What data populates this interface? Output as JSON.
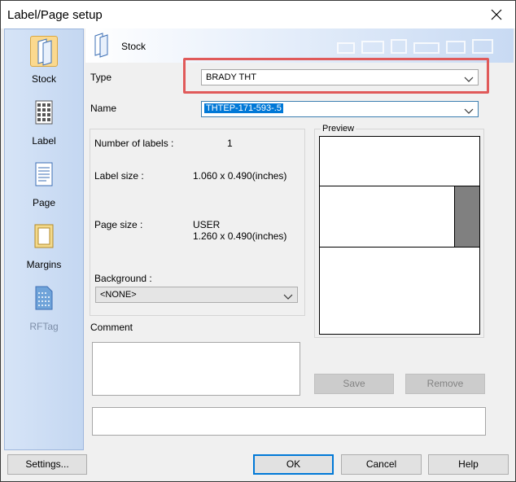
{
  "window": {
    "title": "Label/Page setup"
  },
  "sidebar": {
    "items": [
      {
        "label": "Stock",
        "icon": "stock-icon",
        "selected": true,
        "enabled": true
      },
      {
        "label": "Label",
        "icon": "label-icon",
        "selected": false,
        "enabled": true
      },
      {
        "label": "Page",
        "icon": "page-icon",
        "selected": false,
        "enabled": true
      },
      {
        "label": "Margins",
        "icon": "margins-icon",
        "selected": false,
        "enabled": true
      },
      {
        "label": "RFTag",
        "icon": "rftag-icon",
        "selected": false,
        "enabled": false
      }
    ]
  },
  "banner": {
    "title": "Stock"
  },
  "form": {
    "type_label": "Type",
    "type_value": "BRADY THT",
    "name_label": "Name",
    "name_value": "THTEP-171-593-.5"
  },
  "info": {
    "num_labels_label": "Number of labels :",
    "num_labels_value": "1",
    "label_size_label": "Label size :",
    "label_size_value": "1.060 x 0.490(inches)",
    "page_size_label": "Page size :",
    "page_size_value_line1": "USER",
    "page_size_value_line2": "1.260 x 0.490(inches)",
    "background_label": "Background :",
    "background_value": "<NONE>"
  },
  "preview": {
    "legend": "Preview"
  },
  "comment": {
    "label": "Comment"
  },
  "buttons": {
    "save": "Save",
    "remove": "Remove",
    "settings": "Settings...",
    "ok": "OK",
    "cancel": "Cancel",
    "help": "Help"
  },
  "colors": {
    "highlight": "#e05a5a",
    "selection": "#0078d7",
    "sidebar": "#c4d7f1"
  }
}
